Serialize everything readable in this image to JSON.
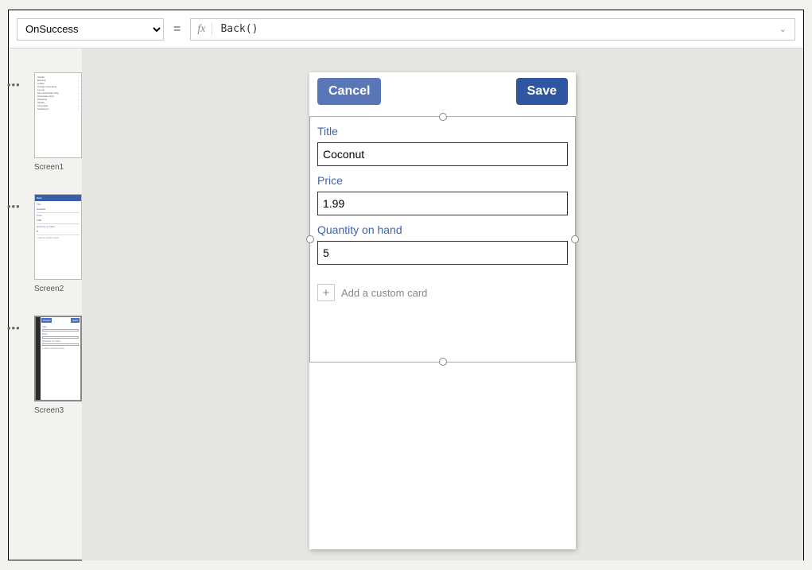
{
  "formula_bar": {
    "property": "OnSuccess",
    "fx_label": "fx",
    "formula": "Back()"
  },
  "thumbnails": {
    "screen1_label": "Screen1",
    "screen2_label": "Screen2",
    "screen3_label": "Screen3"
  },
  "phone": {
    "cancel_label": "Cancel",
    "save_label": "Save",
    "fields": {
      "title_label": "Title",
      "title_value": "Coconut",
      "price_label": "Price",
      "price_value": "1.99",
      "qty_label": "Quantity on hand",
      "qty_value": "5"
    },
    "add_card_label": "Add a custom card"
  }
}
